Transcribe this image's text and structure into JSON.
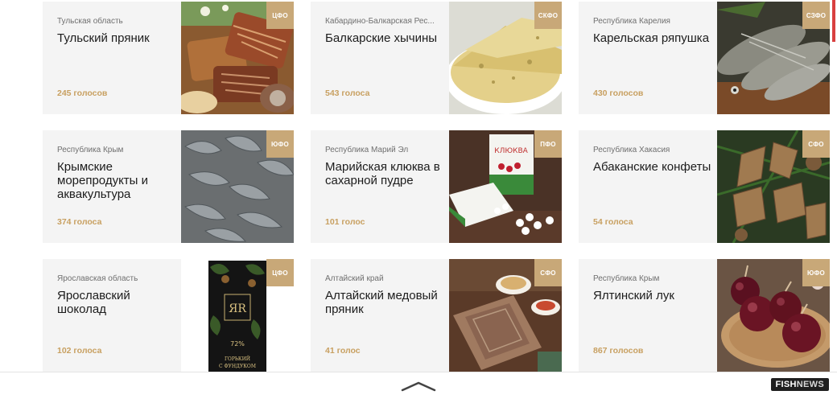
{
  "cards": [
    {
      "region": "Тульская область",
      "title": "Тульский пряник",
      "votes": "245 голосов",
      "badge": "ЦФО"
    },
    {
      "region": "Кабардино-Балкарская Рес...",
      "title": "Балкарские хычины",
      "votes": "543 голоса",
      "badge": "СКФО"
    },
    {
      "region": "Республика Карелия",
      "title": "Карельская ряпушка",
      "votes": "430 голосов",
      "badge": "СЗФО"
    },
    {
      "region": "Республика Крым",
      "title": "Крымские морепродукты и аквакультура",
      "votes": "374 голоса",
      "badge": "ЮФО"
    },
    {
      "region": "Республика Марий Эл",
      "title": "Марийская клюква в сахарной пудре",
      "votes": "101 голос",
      "badge": "ПФО"
    },
    {
      "region": "Республика Хакасия",
      "title": "Абаканские конфеты",
      "votes": "54 голоса",
      "badge": "СФО"
    },
    {
      "region": "Ярославская область",
      "title": "Ярославский шоколад",
      "votes": "102 голоса",
      "badge": "ЦФО"
    },
    {
      "region": "Алтайский край",
      "title": "Алтайский медовый пряник",
      "votes": "41 голос",
      "badge": "СФО"
    },
    {
      "region": "Республика Крым",
      "title": "Ялтинский лук",
      "votes": "867 голосов",
      "badge": "ЮФО"
    }
  ],
  "chocolate_label": {
    "brand": "ЯR",
    "percent": "72%",
    "line1": "ГОРЬКИЙ",
    "line2": "С ФУНДУКОМ"
  },
  "cranberry_label": "КЛЮКВА",
  "logo": {
    "part1": "FISH",
    "part2": "NEWS"
  },
  "icons": {
    "scroll_up": "chevron-up-icon"
  }
}
